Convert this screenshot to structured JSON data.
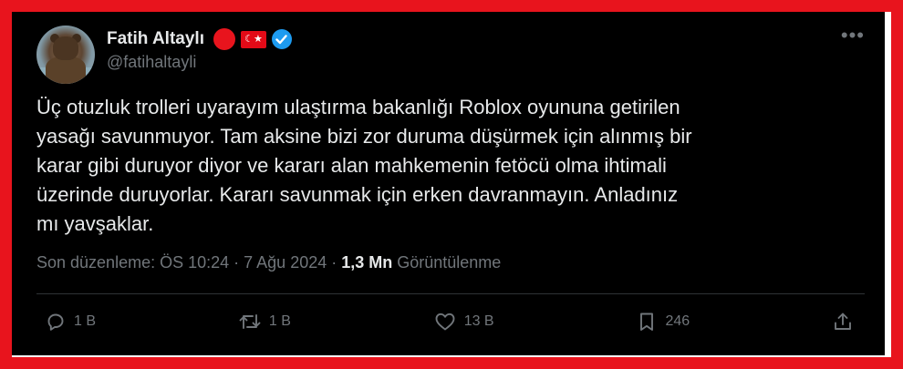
{
  "tweet": {
    "author": {
      "display_name": "Fatih Altaylı",
      "handle": "@fatihaltayli",
      "flag_symbol": "☾★",
      "verified_color": "#1d9bf0"
    },
    "text": "Üç otuzluk trolleri uyarayım ulaştırma bakanlığı Roblox oyununa getirilen\nyasağı savunmuyor. Tam aksine bizi zor duruma düşürmek için alınmış bir\nkarar gibi duruyor diyor ve kararı alan mahkemenin fetöcü olma ihtimali\nüzerinde duruyorlar.  Kararı savunmak için erken davranmayın. Anladınız\nmı yavşaklar.",
    "meta": {
      "edited_label": "Son düzenleme: ÖS 10:24",
      "separator": " · ",
      "date": "7 Ağu 2024",
      "views_count": "1,3 Mn",
      "views_label": " Görüntülenme"
    },
    "actions": {
      "replies": "1 B",
      "retweets": "1 B",
      "likes": "13 B",
      "bookmarks": "246"
    },
    "more_icon": "•••"
  },
  "colors": {
    "frame": "#e8141d",
    "background": "#000000",
    "text": "#e7e9ea",
    "secondary": "#71767b"
  }
}
